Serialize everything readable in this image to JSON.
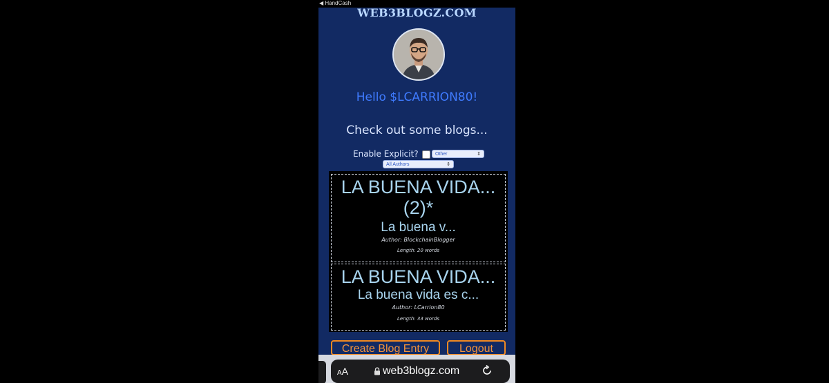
{
  "status_bar": {
    "back_label": "◀ HandCash"
  },
  "site": {
    "title": "WEB3BLOGZ.COM"
  },
  "greeting": {
    "hello": "Hello $LCARRION80!",
    "prompt": "Check out some blogs..."
  },
  "filters": {
    "explicit_label": "Enable Explicit?",
    "category_selected": "Other",
    "author_selected": "All Authors"
  },
  "blogs": [
    {
      "title_line1": "LA BUENA VIDA...",
      "title_line2": "(2)*",
      "snippet": "La buena v...",
      "author": "Author: BlockchainBlogger",
      "length": "Length: 20 words"
    },
    {
      "title_line1": "LA BUENA VIDA...",
      "snippet": "La buena vida es c...",
      "author": "Author: LCarrion80",
      "length": "Length: 33 words"
    }
  ],
  "actions": {
    "create_label": "Create Blog Entry",
    "logout_label": "Logout"
  },
  "browser": {
    "aa_label_a": "A",
    "aa_label_b": "A",
    "url": "web3blogz.com"
  }
}
